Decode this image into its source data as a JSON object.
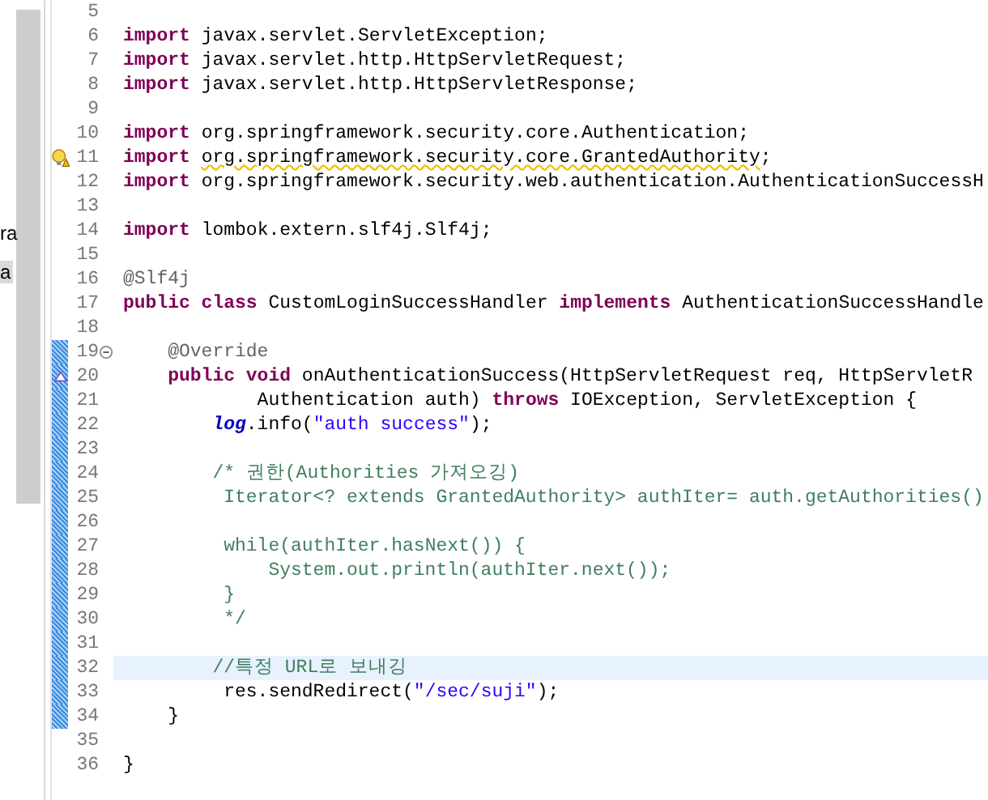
{
  "explorer": {
    "items": [
      {
        "label": "ra",
        "selected": false
      },
      {
        "label": "a",
        "selected": true
      }
    ]
  },
  "editor": {
    "lines": [
      {
        "number": "5",
        "changed": false,
        "current": false
      },
      {
        "number": "6",
        "tokens": [
          {
            "kind": "keyword",
            "text": "import"
          },
          {
            "kind": "plain",
            "text": " javax.servlet.ServletException;"
          }
        ],
        "changed": false,
        "current": false
      },
      {
        "number": "7",
        "tokens": [
          {
            "kind": "keyword",
            "text": "import"
          },
          {
            "kind": "plain",
            "text": " javax.servlet.http.HttpServletRequest;"
          }
        ],
        "changed": false,
        "current": false
      },
      {
        "number": "8",
        "tokens": [
          {
            "kind": "keyword",
            "text": "import"
          },
          {
            "kind": "plain",
            "text": " javax.servlet.http.HttpServletResponse;"
          }
        ],
        "changed": false,
        "current": false
      },
      {
        "number": "9",
        "changed": false,
        "current": false
      },
      {
        "number": "10",
        "tokens": [
          {
            "kind": "keyword",
            "text": "import"
          },
          {
            "kind": "plain",
            "text": " org.springframework.security.core.Authentication;"
          }
        ],
        "changed": false,
        "current": false
      },
      {
        "number": "11",
        "kind": "warning",
        "tokens": [
          {
            "kind": "keyword",
            "text": "import "
          },
          {
            "kind": "warned",
            "text": "org.springframework.security.core.GrantedAuthority"
          },
          {
            "kind": "plain",
            "text": ";"
          }
        ],
        "changed": false,
        "current": false
      },
      {
        "number": "12",
        "tokens": [
          {
            "kind": "keyword",
            "text": "import"
          },
          {
            "kind": "plain",
            "text": " org.springframework.security.web.authentication.AuthenticationSuccessH"
          }
        ],
        "changed": false,
        "current": false
      },
      {
        "number": "13",
        "changed": false,
        "current": false
      },
      {
        "number": "14",
        "tokens": [
          {
            "kind": "keyword",
            "text": "import"
          },
          {
            "kind": "plain",
            "text": " lombok.extern.slf4j.Slf4j;"
          }
        ],
        "changed": false,
        "current": false
      },
      {
        "number": "15",
        "changed": false,
        "current": false
      },
      {
        "number": "16",
        "tokens": [
          {
            "kind": "annotation",
            "text": "@Slf4j"
          }
        ],
        "changed": false,
        "current": false
      },
      {
        "number": "17",
        "tokens": [
          {
            "kind": "keyword",
            "text": "public class"
          },
          {
            "kind": "plain",
            "text": " CustomLoginSuccessHandler "
          },
          {
            "kind": "keyword",
            "text": "implements"
          },
          {
            "kind": "plain",
            "text": " AuthenticationSuccessHandle"
          }
        ],
        "changed": false,
        "current": false
      },
      {
        "number": "18",
        "changed": false,
        "current": false
      },
      {
        "number": "19",
        "kind": "fold",
        "tokens": [
          {
            "kind": "annotation",
            "text": "    @Override"
          }
        ],
        "changed": true,
        "current": false
      },
      {
        "number": "20",
        "kind": "override",
        "tokens": [
          {
            "kind": "keyword",
            "text": "    public void"
          },
          {
            "kind": "plain",
            "text": " onAuthenticationSuccess(HttpServletRequest req, HttpServletR"
          }
        ],
        "changed": true,
        "current": false
      },
      {
        "number": "21",
        "tokens": [
          {
            "kind": "plain",
            "text": "            Authentication auth) "
          },
          {
            "kind": "keyword",
            "text": "throws"
          },
          {
            "kind": "plain",
            "text": " IOException, ServletException {"
          }
        ],
        "changed": true,
        "current": false
      },
      {
        "number": "22",
        "tokens": [
          {
            "kind": "field",
            "text": "        log"
          },
          {
            "kind": "plain",
            "text": ".info("
          },
          {
            "kind": "string",
            "text": "\"auth success\""
          },
          {
            "kind": "plain",
            "text": ");"
          }
        ],
        "changed": true,
        "current": false
      },
      {
        "number": "23",
        "changed": true,
        "current": false
      },
      {
        "number": "24",
        "tokens": [
          {
            "kind": "comment",
            "text": "        /* 권한(Authorities 가져오깅)"
          }
        ],
        "changed": true,
        "current": false
      },
      {
        "number": "25",
        "tokens": [
          {
            "kind": "comment",
            "text": "         Iterator<? extends GrantedAuthority> authIter= auth.getAuthorities()"
          }
        ],
        "changed": true,
        "current": false
      },
      {
        "number": "26",
        "changed": true,
        "current": false
      },
      {
        "number": "27",
        "tokens": [
          {
            "kind": "comment",
            "text": "         while(authIter.hasNext()) {"
          }
        ],
        "changed": true,
        "current": false
      },
      {
        "number": "28",
        "tokens": [
          {
            "kind": "comment",
            "text": "             System.out.println(authIter.next());"
          }
        ],
        "changed": true,
        "current": false
      },
      {
        "number": "29",
        "tokens": [
          {
            "kind": "comment",
            "text": "         }"
          }
        ],
        "changed": true,
        "current": false
      },
      {
        "number": "30",
        "tokens": [
          {
            "kind": "comment",
            "text": "         */"
          }
        ],
        "changed": true,
        "current": false
      },
      {
        "number": "31",
        "changed": true,
        "current": false
      },
      {
        "number": "32",
        "tokens": [
          {
            "kind": "comment",
            "text": "        //특정 URL로 보내깅"
          }
        ],
        "changed": true,
        "current": true
      },
      {
        "number": "33",
        "tokens": [
          {
            "kind": "plain",
            "text": "         res.sendRedirect("
          },
          {
            "kind": "string",
            "text": "\"/sec/suji\""
          },
          {
            "kind": "plain",
            "text": ");"
          }
        ],
        "changed": true,
        "current": false
      },
      {
        "number": "34",
        "tokens": [
          {
            "kind": "plain",
            "text": "    }"
          }
        ],
        "changed": true,
        "current": false
      },
      {
        "number": "35",
        "changed": false,
        "current": false
      },
      {
        "number": "36",
        "tokens": [
          {
            "kind": "plain",
            "text": "}"
          }
        ],
        "changed": false,
        "current": false
      }
    ]
  }
}
